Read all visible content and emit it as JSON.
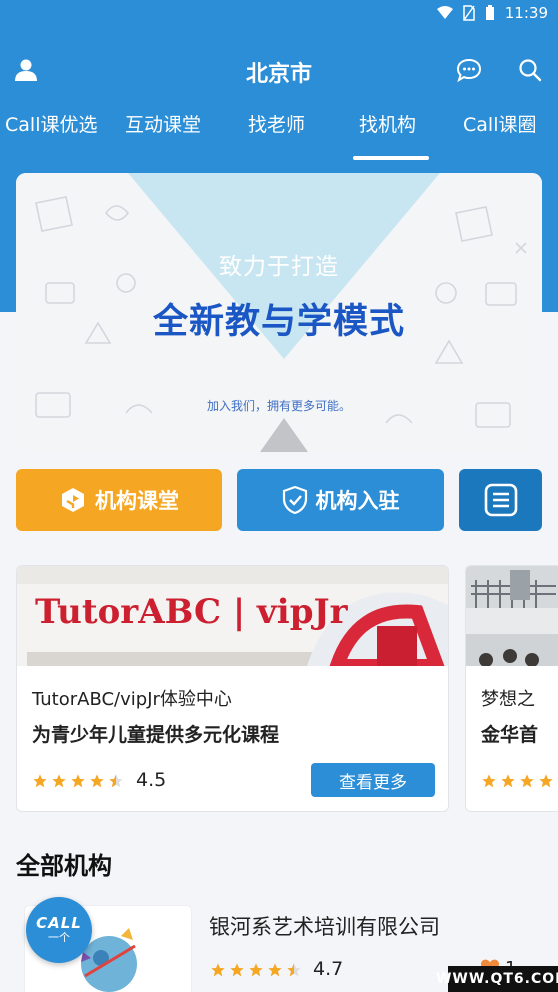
{
  "status_bar": {
    "time": "11:39"
  },
  "header": {
    "city": "北京市"
  },
  "tabs": [
    {
      "label": "Call课优选"
    },
    {
      "label": "互动课堂"
    },
    {
      "label": "找老师"
    },
    {
      "label": "找机构"
    },
    {
      "label": "Call课圈"
    }
  ],
  "selected_tab": "找机构",
  "banner": {
    "subtitle": "致力于打造",
    "title": "全新教与学模式",
    "caption": "加入我们，拥有更多可能。"
  },
  "actions": {
    "classroom_label": "机构课堂",
    "join_label": "机构入驻"
  },
  "featured": [
    {
      "sign": "TutorABC | vipJr",
      "name": "TutorABC/vipJr体验中心",
      "desc": "为青少年儿童提供多元化课程",
      "rating": "4.5",
      "stars": 4.5,
      "more_label": "查看更多"
    },
    {
      "name": "梦想之",
      "desc": "金华首",
      "stars": 4
    }
  ],
  "section": {
    "title": "全部机构"
  },
  "institutions": [
    {
      "name": "银河系艺术培训有限公司",
      "rating": "4.7",
      "stars": 4.5,
      "likes": "1"
    }
  ],
  "call_button": {
    "top": "CALL",
    "sub": "一个"
  },
  "watermark": "WWW.QT6.COM",
  "colors": {
    "primary": "#2b8ed6",
    "accent_orange": "#f5a623",
    "star": "#f5a623",
    "like": "#f28a3c"
  }
}
